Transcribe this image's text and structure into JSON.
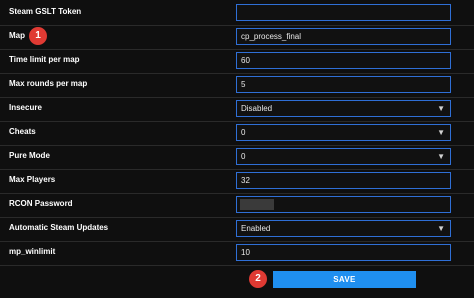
{
  "form": {
    "rows": [
      {
        "label": "Steam GSLT Token",
        "value": ""
      },
      {
        "label": "Map",
        "value": "cp_process_final"
      },
      {
        "label": "Time limit per map",
        "value": "60"
      },
      {
        "label": "Max rounds per map",
        "value": "5"
      },
      {
        "label": "Insecure",
        "value": "Disabled"
      },
      {
        "label": "Cheats",
        "value": "0"
      },
      {
        "label": "Pure Mode",
        "value": "0"
      },
      {
        "label": "Max Players",
        "value": "32"
      },
      {
        "label": "RCON Password",
        "value": ""
      },
      {
        "label": "Automatic Steam Updates",
        "value": "Enabled"
      },
      {
        "label": "mp_winlimit",
        "value": "10"
      }
    ]
  },
  "annotations": {
    "badge_1": "1",
    "badge_2": "2"
  },
  "actions": {
    "save_label": "SAVE"
  },
  "icons": {
    "dropdown": "chevron-down-icon"
  },
  "colors": {
    "field_border": "#2f6fd6",
    "save_button": "#1f8ff0",
    "badge": "#e03a33"
  }
}
